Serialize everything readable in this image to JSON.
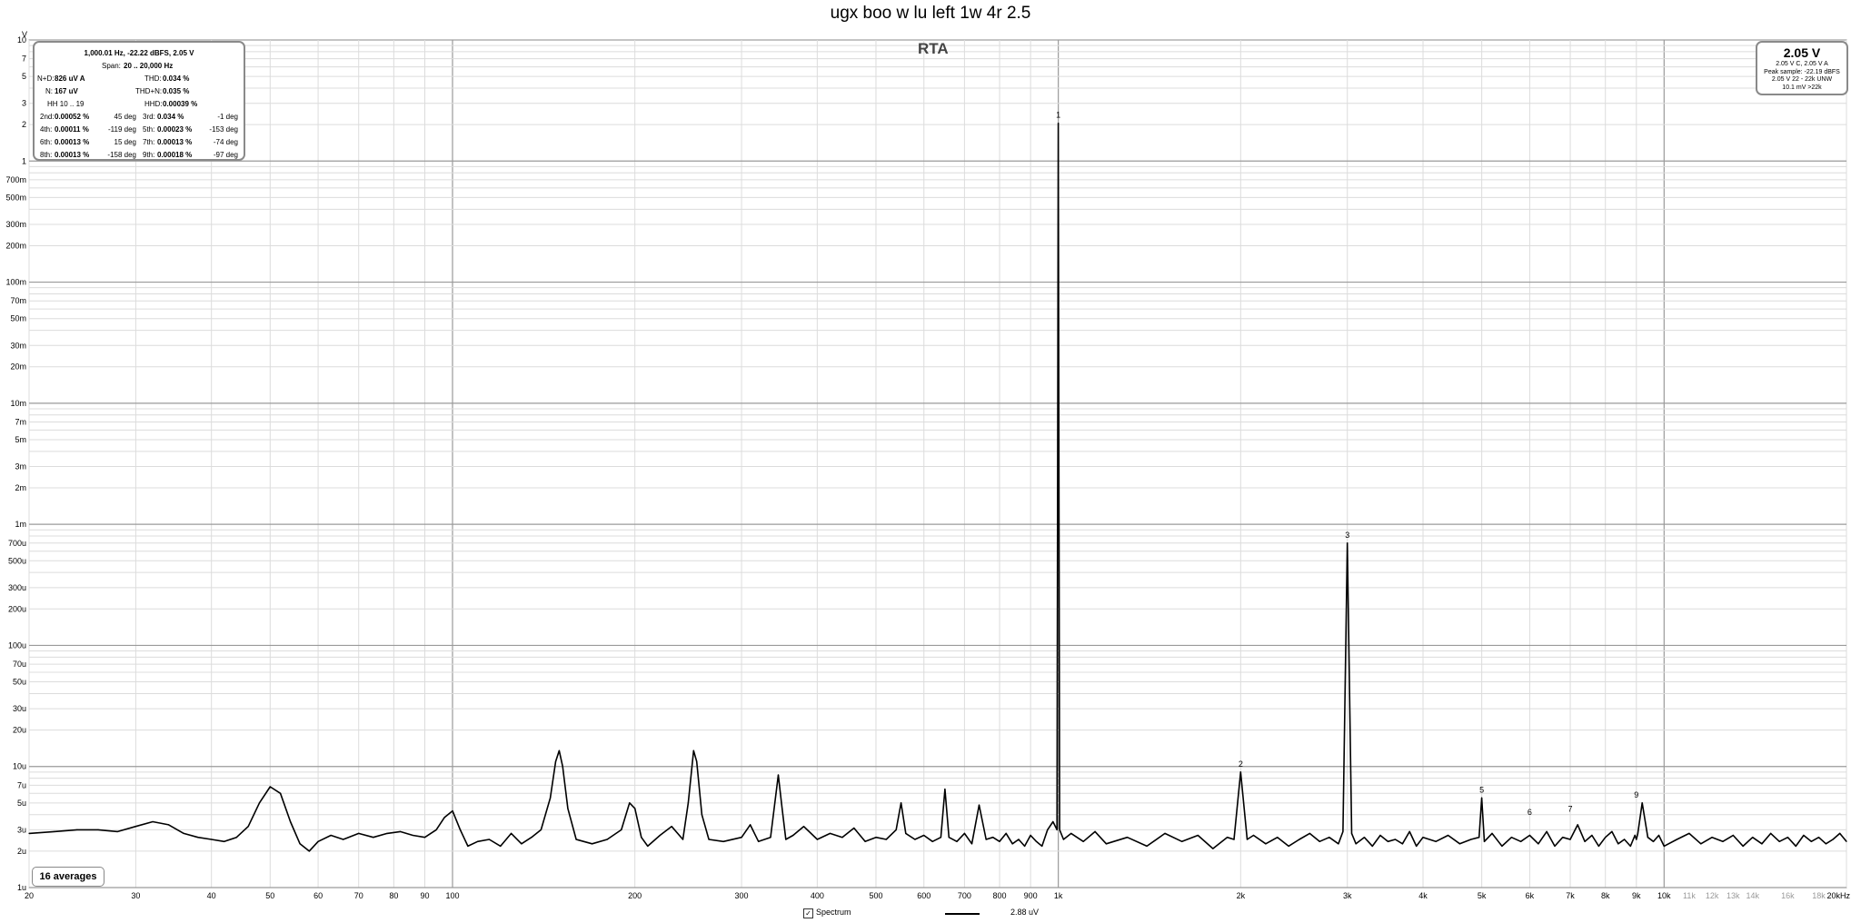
{
  "title": "ugx boo w lu left 1w 4r 2.5",
  "plot_label": "RTA",
  "averages_label": "16 averages",
  "legend": {
    "checkbox_mark": "✓",
    "series_name": "Spectrum",
    "series_value": "2.88 uV"
  },
  "distortion_panel": {
    "header": "1,000.01 Hz, -22.22 dBFS, 2.05 V",
    "span_label": "Span:",
    "span_value": "20 .. 20,000 Hz",
    "nd_label": "N+D:",
    "nd_value": "826 uV A",
    "thd_label": "THD:",
    "thd_value": "0.034 %",
    "n_label": "N:",
    "n_value": "167 uV",
    "thdn_label": "THD+N:",
    "thdn_value": "0.035 %",
    "hh_label": "HH 10 .. 19",
    "hhd_label": "HHD:",
    "hhd_value": "0.00039 %",
    "harmonics": [
      {
        "label": "2nd:",
        "value": "0.00052 %",
        "phase": "45 deg"
      },
      {
        "label": "3rd:",
        "value": "0.034 %",
        "phase": "-1 deg"
      },
      {
        "label": "4th:",
        "value": "0.00011 %",
        "phase": "-119 deg"
      },
      {
        "label": "5th:",
        "value": "0.00023 %",
        "phase": "-153 deg"
      },
      {
        "label": "6th:",
        "value": "0.00013 %",
        "phase": "15 deg"
      },
      {
        "label": "7th:",
        "value": "0.00013 %",
        "phase": "-74 deg"
      },
      {
        "label": "8th:",
        "value": "0.00013 %",
        "phase": "-158 deg"
      },
      {
        "label": "9th:",
        "value": "0.00018 %",
        "phase": "-97 deg"
      }
    ]
  },
  "voltage_panel": {
    "main": "2.05 V",
    "lines": [
      "2.05 V C, 2.05 V A",
      "Peak sample: -22.19 dBFS",
      "2.05 V 22 - 22k UNW",
      "10.1 mV >22k"
    ]
  },
  "chart_data": {
    "type": "line",
    "title": "ugx boo w lu left 1w 4r 2.5",
    "xlabel": "",
    "ylabel": "V",
    "x_scale": "log",
    "y_scale": "log",
    "xlim": [
      20,
      20000
    ],
    "ylim": [
      1e-06,
      10
    ],
    "grid": true,
    "x_ticks": [
      {
        "v": 20,
        "l": "20"
      },
      {
        "v": 30,
        "l": "30"
      },
      {
        "v": 40,
        "l": "40"
      },
      {
        "v": 50,
        "l": "50"
      },
      {
        "v": 60,
        "l": "60"
      },
      {
        "v": 70,
        "l": "70"
      },
      {
        "v": 80,
        "l": "80"
      },
      {
        "v": 90,
        "l": "90"
      },
      {
        "v": 100,
        "l": "100"
      },
      {
        "v": 200,
        "l": "200"
      },
      {
        "v": 300,
        "l": "300"
      },
      {
        "v": 400,
        "l": "400"
      },
      {
        "v": 500,
        "l": "500"
      },
      {
        "v": 600,
        "l": "600"
      },
      {
        "v": 700,
        "l": "700"
      },
      {
        "v": 800,
        "l": "800"
      },
      {
        "v": 900,
        "l": "900"
      },
      {
        "v": 1000,
        "l": "1k"
      },
      {
        "v": 2000,
        "l": "2k"
      },
      {
        "v": 3000,
        "l": "3k"
      },
      {
        "v": 4000,
        "l": "4k"
      },
      {
        "v": 5000,
        "l": "5k"
      },
      {
        "v": 6000,
        "l": "6k"
      },
      {
        "v": 7000,
        "l": "7k"
      },
      {
        "v": 8000,
        "l": "8k"
      },
      {
        "v": 9000,
        "l": "9k"
      },
      {
        "v": 10000,
        "l": "10k"
      },
      {
        "v": 11000,
        "l": "11k"
      },
      {
        "v": 12000,
        "l": "12k"
      },
      {
        "v": 13000,
        "l": "13k"
      },
      {
        "v": 14000,
        "l": "14k"
      },
      {
        "v": 16000,
        "l": "16k"
      },
      {
        "v": 18000,
        "l": "18k"
      },
      {
        "v": 20000,
        "l": "20kHz"
      }
    ],
    "y_ticks": [
      {
        "v": 10,
        "l": "10"
      },
      {
        "v": 7,
        "l": "7"
      },
      {
        "v": 5,
        "l": "5"
      },
      {
        "v": 3,
        "l": "3"
      },
      {
        "v": 2,
        "l": "2"
      },
      {
        "v": 1,
        "l": "1"
      },
      {
        "v": 0.7,
        "l": "700m"
      },
      {
        "v": 0.5,
        "l": "500m"
      },
      {
        "v": 0.3,
        "l": "300m"
      },
      {
        "v": 0.2,
        "l": "200m"
      },
      {
        "v": 0.1,
        "l": "100m"
      },
      {
        "v": 0.07,
        "l": "70m"
      },
      {
        "v": 0.05,
        "l": "50m"
      },
      {
        "v": 0.03,
        "l": "30m"
      },
      {
        "v": 0.02,
        "l": "20m"
      },
      {
        "v": 0.01,
        "l": "10m"
      },
      {
        "v": 0.007,
        "l": "7m"
      },
      {
        "v": 0.005,
        "l": "5m"
      },
      {
        "v": 0.003,
        "l": "3m"
      },
      {
        "v": 0.002,
        "l": "2m"
      },
      {
        "v": 0.001,
        "l": "1m"
      },
      {
        "v": 0.0007,
        "l": "700u"
      },
      {
        "v": 0.0005,
        "l": "500u"
      },
      {
        "v": 0.0003,
        "l": "300u"
      },
      {
        "v": 0.0002,
        "l": "200u"
      },
      {
        "v": 0.0001,
        "l": "100u"
      },
      {
        "v": 7e-05,
        "l": "70u"
      },
      {
        "v": 5e-05,
        "l": "50u"
      },
      {
        "v": 3e-05,
        "l": "30u"
      },
      {
        "v": 2e-05,
        "l": "20u"
      },
      {
        "v": 1e-05,
        "l": "10u"
      },
      {
        "v": 7e-06,
        "l": "7u"
      },
      {
        "v": 5e-06,
        "l": "5u"
      },
      {
        "v": 3e-06,
        "l": "3u"
      },
      {
        "v": 2e-06,
        "l": "2u"
      },
      {
        "v": 1e-06,
        "l": "1u"
      }
    ],
    "series": [
      {
        "name": "Spectrum",
        "color": "#000000",
        "x": [
          20,
          22,
          24,
          26,
          28,
          30,
          32,
          34,
          36,
          38,
          40,
          42,
          44,
          46,
          48,
          50,
          52,
          54,
          56,
          58,
          60,
          63,
          66,
          70,
          74,
          78,
          82,
          86,
          90,
          94,
          97,
          100,
          103,
          106,
          110,
          115,
          120,
          125,
          130,
          135,
          140,
          145,
          148,
          150,
          152,
          155,
          160,
          170,
          180,
          190,
          196,
          200,
          205,
          210,
          220,
          230,
          240,
          245,
          250,
          253,
          258,
          265,
          280,
          300,
          310,
          320,
          335,
          345,
          350,
          355,
          365,
          380,
          400,
          420,
          440,
          460,
          480,
          500,
          520,
          540,
          550,
          560,
          580,
          600,
          620,
          640,
          650,
          660,
          680,
          700,
          720,
          740,
          760,
          780,
          800,
          820,
          840,
          860,
          880,
          900,
          920,
          940,
          960,
          980,
          995,
          1000,
          1005,
          1020,
          1050,
          1100,
          1150,
          1200,
          1300,
          1400,
          1500,
          1600,
          1700,
          1800,
          1900,
          1950,
          2000,
          2050,
          2100,
          2200,
          2300,
          2400,
          2500,
          2600,
          2700,
          2800,
          2900,
          2950,
          3000,
          3050,
          3100,
          3200,
          3300,
          3400,
          3500,
          3600,
          3700,
          3800,
          3900,
          4000,
          4200,
          4400,
          4600,
          4800,
          4950,
          5000,
          5050,
          5200,
          5400,
          5600,
          5800,
          6000,
          6200,
          6400,
          6600,
          6800,
          7000,
          7200,
          7400,
          7600,
          7800,
          8000,
          8200,
          8400,
          8600,
          8800,
          8950,
          9000,
          9050,
          9200,
          9400,
          9600,
          9800,
          10000,
          10500,
          11000,
          11500,
          12000,
          12500,
          13000,
          13500,
          14000,
          14500,
          15000,
          15500,
          16000,
          16500,
          17000,
          17500,
          18000,
          18500,
          19000,
          19500,
          20000
        ],
        "y": [
          2.8e-06,
          2.9e-06,
          3e-06,
          3e-06,
          2.9e-06,
          3.2e-06,
          3.5e-06,
          3.3e-06,
          2.8e-06,
          2.6e-06,
          2.5e-06,
          2.4e-06,
          2.6e-06,
          3.2e-06,
          5e-06,
          6.8e-06,
          6e-06,
          3.5e-06,
          2.3e-06,
          2e-06,
          2.4e-06,
          2.7e-06,
          2.5e-06,
          2.8e-06,
          2.6e-06,
          2.8e-06,
          2.9e-06,
          2.7e-06,
          2.6e-06,
          3e-06,
          3.8e-06,
          4.3e-06,
          3e-06,
          2.2e-06,
          2.4e-06,
          2.5e-06,
          2.2e-06,
          2.8e-06,
          2.3e-06,
          2.6e-06,
          3e-06,
          5.5e-06,
          1.1e-05,
          1.35e-05,
          1e-05,
          4.5e-06,
          2.5e-06,
          2.3e-06,
          2.5e-06,
          3e-06,
          5e-06,
          4.5e-06,
          2.6e-06,
          2.2e-06,
          2.7e-06,
          3.2e-06,
          2.5e-06,
          5e-06,
          1.35e-05,
          1.1e-05,
          4e-06,
          2.5e-06,
          2.4e-06,
          2.6e-06,
          3.3e-06,
          2.4e-06,
          2.6e-06,
          8.5e-06,
          4.5e-06,
          2.5e-06,
          2.7e-06,
          3.2e-06,
          2.5e-06,
          2.8e-06,
          2.6e-06,
          3.1e-06,
          2.4e-06,
          2.6e-06,
          2.5e-06,
          3e-06,
          5e-06,
          2.8e-06,
          2.5e-06,
          2.7e-06,
          2.4e-06,
          2.6e-06,
          6.5e-06,
          2.6e-06,
          2.4e-06,
          2.8e-06,
          2.3e-06,
          4.8e-06,
          2.5e-06,
          2.6e-06,
          2.4e-06,
          2.8e-06,
          2.3e-06,
          2.5e-06,
          2.2e-06,
          2.7e-06,
          2.4e-06,
          2.2e-06,
          3e-06,
          3.5e-06,
          3e-06,
          2.05,
          3e-06,
          2.5e-06,
          2.8e-06,
          2.4e-06,
          2.9e-06,
          2.3e-06,
          2.6e-06,
          2.2e-06,
          2.8e-06,
          2.4e-06,
          2.7e-06,
          2.1e-06,
          2.6e-06,
          2.5e-06,
          9e-06,
          2.5e-06,
          2.7e-06,
          2.3e-06,
          2.6e-06,
          2.2e-06,
          2.5e-06,
          2.8e-06,
          2.4e-06,
          2.6e-06,
          2.3e-06,
          2.9e-06,
          0.0007,
          2.8e-06,
          2.3e-06,
          2.6e-06,
          2.2e-06,
          2.7e-06,
          2.4e-06,
          2.5e-06,
          2.3e-06,
          2.9e-06,
          2.2e-06,
          2.6e-06,
          2.4e-06,
          2.7e-06,
          2.3e-06,
          2.5e-06,
          2.6e-06,
          5.5e-06,
          2.4e-06,
          2.8e-06,
          2.2e-06,
          2.6e-06,
          2.4e-06,
          2.7e-06,
          2.3e-06,
          2.9e-06,
          2.2e-06,
          2.6e-06,
          2.5e-06,
          3.3e-06,
          2.4e-06,
          2.7e-06,
          2.2e-06,
          2.6e-06,
          2.9e-06,
          2.3e-06,
          2.5e-06,
          2.2e-06,
          2.7e-06,
          2.5e-06,
          2.8e-06,
          5e-06,
          2.6e-06,
          2.4e-06,
          2.7e-06,
          2.2e-06,
          2.5e-06,
          2.8e-06,
          2.3e-06,
          2.6e-06,
          2.4e-06,
          2.7e-06,
          2.2e-06,
          2.6e-06,
          2.3e-06,
          2.8e-06,
          2.4e-06,
          2.6e-06,
          2.2e-06,
          2.7e-06,
          2.4e-06,
          2.6e-06,
          2.3e-06,
          2.5e-06,
          2.8e-06,
          2.4e-06
        ]
      }
    ],
    "harmonic_markers": [
      {
        "label": "1",
        "x": 1000,
        "y": 2.05
      },
      {
        "label": "2",
        "x": 2000,
        "y": 9e-06
      },
      {
        "label": "3",
        "x": 3000,
        "y": 0.0007
      },
      {
        "label": "5",
        "x": 5000,
        "y": 5.5e-06
      },
      {
        "label": "6",
        "x": 6000,
        "y": 3.6e-06
      },
      {
        "label": "7",
        "x": 7000,
        "y": 3.8e-06
      },
      {
        "label": "9",
        "x": 9000,
        "y": 5e-06
      }
    ]
  }
}
